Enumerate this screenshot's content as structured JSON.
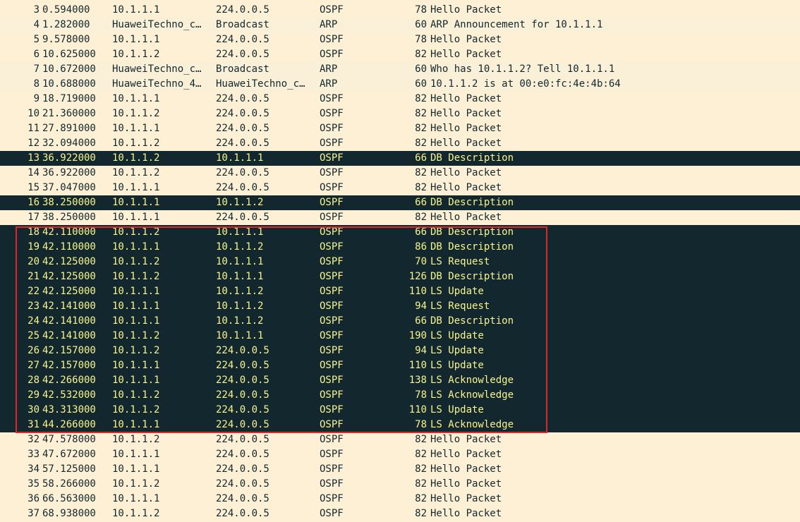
{
  "packets": [
    {
      "no": "3",
      "time": "0.594000",
      "source": "10.1.1.1",
      "destination": "224.0.0.5",
      "protocol": "OSPF",
      "length": "78",
      "info": "Hello Packet",
      "style": "ospf"
    },
    {
      "no": "4",
      "time": "1.282000",
      "source": "HuaweiTechno_c…",
      "destination": "Broadcast",
      "protocol": "ARP",
      "length": "60",
      "info": "ARP Announcement for 10.1.1.1",
      "style": "arp"
    },
    {
      "no": "5",
      "time": "9.578000",
      "source": "10.1.1.1",
      "destination": "224.0.0.5",
      "protocol": "OSPF",
      "length": "78",
      "info": "Hello Packet",
      "style": "ospf"
    },
    {
      "no": "6",
      "time": "10.625000",
      "source": "10.1.1.2",
      "destination": "224.0.0.5",
      "protocol": "OSPF",
      "length": "82",
      "info": "Hello Packet",
      "style": "ospf"
    },
    {
      "no": "7",
      "time": "10.672000",
      "source": "HuaweiTechno_c…",
      "destination": "Broadcast",
      "protocol": "ARP",
      "length": "60",
      "info": "Who has 10.1.1.2? Tell 10.1.1.1",
      "style": "arp"
    },
    {
      "no": "8",
      "time": "10.688000",
      "source": "HuaweiTechno_4…",
      "destination": "HuaweiTechno_c…",
      "protocol": "ARP",
      "length": "60",
      "info": "10.1.1.2 is at 00:e0:fc:4e:4b:64",
      "style": "arp"
    },
    {
      "no": "9",
      "time": "18.719000",
      "source": "10.1.1.1",
      "destination": "224.0.0.5",
      "protocol": "OSPF",
      "length": "82",
      "info": "Hello Packet",
      "style": "ospf"
    },
    {
      "no": "10",
      "time": "21.360000",
      "source": "10.1.1.2",
      "destination": "224.0.0.5",
      "protocol": "OSPF",
      "length": "82",
      "info": "Hello Packet",
      "style": "ospf"
    },
    {
      "no": "11",
      "time": "27.891000",
      "source": "10.1.1.1",
      "destination": "224.0.0.5",
      "protocol": "OSPF",
      "length": "82",
      "info": "Hello Packet",
      "style": "ospf"
    },
    {
      "no": "12",
      "time": "32.094000",
      "source": "10.1.1.2",
      "destination": "224.0.0.5",
      "protocol": "OSPF",
      "length": "82",
      "info": "Hello Packet",
      "style": "ospf"
    },
    {
      "no": "13",
      "time": "36.922000",
      "source": "10.1.1.2",
      "destination": "10.1.1.1",
      "protocol": "OSPF",
      "length": "66",
      "info": "DB Description",
      "style": "marked"
    },
    {
      "no": "14",
      "time": "36.922000",
      "source": "10.1.1.2",
      "destination": "224.0.0.5",
      "protocol": "OSPF",
      "length": "82",
      "info": "Hello Packet",
      "style": "ospf"
    },
    {
      "no": "15",
      "time": "37.047000",
      "source": "10.1.1.1",
      "destination": "224.0.0.5",
      "protocol": "OSPF",
      "length": "82",
      "info": "Hello Packet",
      "style": "ospf"
    },
    {
      "no": "16",
      "time": "38.250000",
      "source": "10.1.1.1",
      "destination": "10.1.1.2",
      "protocol": "OSPF",
      "length": "66",
      "info": "DB Description",
      "style": "marked"
    },
    {
      "no": "17",
      "time": "38.250000",
      "source": "10.1.1.1",
      "destination": "224.0.0.5",
      "protocol": "OSPF",
      "length": "82",
      "info": "Hello Packet",
      "style": "ospf"
    },
    {
      "no": "18",
      "time": "42.110000",
      "source": "10.1.1.2",
      "destination": "10.1.1.1",
      "protocol": "OSPF",
      "length": "66",
      "info": "DB Description",
      "style": "marked"
    },
    {
      "no": "19",
      "time": "42.110000",
      "source": "10.1.1.1",
      "destination": "10.1.1.2",
      "protocol": "OSPF",
      "length": "86",
      "info": "DB Description",
      "style": "marked"
    },
    {
      "no": "20",
      "time": "42.125000",
      "source": "10.1.1.2",
      "destination": "10.1.1.1",
      "protocol": "OSPF",
      "length": "70",
      "info": "LS Request",
      "style": "marked"
    },
    {
      "no": "21",
      "time": "42.125000",
      "source": "10.1.1.2",
      "destination": "10.1.1.1",
      "protocol": "OSPF",
      "length": "126",
      "info": "DB Description",
      "style": "marked"
    },
    {
      "no": "22",
      "time": "42.125000",
      "source": "10.1.1.1",
      "destination": "10.1.1.2",
      "protocol": "OSPF",
      "length": "110",
      "info": "LS Update",
      "style": "marked"
    },
    {
      "no": "23",
      "time": "42.141000",
      "source": "10.1.1.1",
      "destination": "10.1.1.2",
      "protocol": "OSPF",
      "length": "94",
      "info": "LS Request",
      "style": "marked"
    },
    {
      "no": "24",
      "time": "42.141000",
      "source": "10.1.1.1",
      "destination": "10.1.1.2",
      "protocol": "OSPF",
      "length": "66",
      "info": "DB Description",
      "style": "marked"
    },
    {
      "no": "25",
      "time": "42.141000",
      "source": "10.1.1.2",
      "destination": "10.1.1.1",
      "protocol": "OSPF",
      "length": "190",
      "info": "LS Update",
      "style": "marked"
    },
    {
      "no": "26",
      "time": "42.157000",
      "source": "10.1.1.2",
      "destination": "224.0.0.5",
      "protocol": "OSPF",
      "length": "94",
      "info": "LS Update",
      "style": "marked"
    },
    {
      "no": "27",
      "time": "42.157000",
      "source": "10.1.1.1",
      "destination": "224.0.0.5",
      "protocol": "OSPF",
      "length": "110",
      "info": "LS Update",
      "style": "marked"
    },
    {
      "no": "28",
      "time": "42.266000",
      "source": "10.1.1.1",
      "destination": "224.0.0.5",
      "protocol": "OSPF",
      "length": "138",
      "info": "LS Acknowledge",
      "style": "marked"
    },
    {
      "no": "29",
      "time": "42.532000",
      "source": "10.1.1.2",
      "destination": "224.0.0.5",
      "protocol": "OSPF",
      "length": "78",
      "info": "LS Acknowledge",
      "style": "marked"
    },
    {
      "no": "30",
      "time": "43.313000",
      "source": "10.1.1.2",
      "destination": "224.0.0.5",
      "protocol": "OSPF",
      "length": "110",
      "info": "LS Update",
      "style": "marked"
    },
    {
      "no": "31",
      "time": "44.266000",
      "source": "10.1.1.1",
      "destination": "224.0.0.5",
      "protocol": "OSPF",
      "length": "78",
      "info": "LS Acknowledge",
      "style": "marked"
    },
    {
      "no": "32",
      "time": "47.578000",
      "source": "10.1.1.2",
      "destination": "224.0.0.5",
      "protocol": "OSPF",
      "length": "82",
      "info": "Hello Packet",
      "style": "ospf"
    },
    {
      "no": "33",
      "time": "47.672000",
      "source": "10.1.1.1",
      "destination": "224.0.0.5",
      "protocol": "OSPF",
      "length": "82",
      "info": "Hello Packet",
      "style": "ospf"
    },
    {
      "no": "34",
      "time": "57.125000",
      "source": "10.1.1.1",
      "destination": "224.0.0.5",
      "protocol": "OSPF",
      "length": "82",
      "info": "Hello Packet",
      "style": "ospf"
    },
    {
      "no": "35",
      "time": "58.266000",
      "source": "10.1.1.2",
      "destination": "224.0.0.5",
      "protocol": "OSPF",
      "length": "82",
      "info": "Hello Packet",
      "style": "ospf"
    },
    {
      "no": "36",
      "time": "66.563000",
      "source": "10.1.1.1",
      "destination": "224.0.0.5",
      "protocol": "OSPF",
      "length": "82",
      "info": "Hello Packet",
      "style": "ospf"
    },
    {
      "no": "37",
      "time": "68.938000",
      "source": "10.1.1.2",
      "destination": "224.0.0.5",
      "protocol": "OSPF",
      "length": "82",
      "info": "Hello Packet",
      "style": "ospf"
    }
  ],
  "colors": {
    "ospf_row_bg": "#fdf0d5",
    "arp_row_bg": "#faf0d7",
    "normal_text": "#12272e",
    "marked_row_bg": "#12272e",
    "marked_row_text": "#f7f58c",
    "highlight_box": "#e0252b"
  }
}
